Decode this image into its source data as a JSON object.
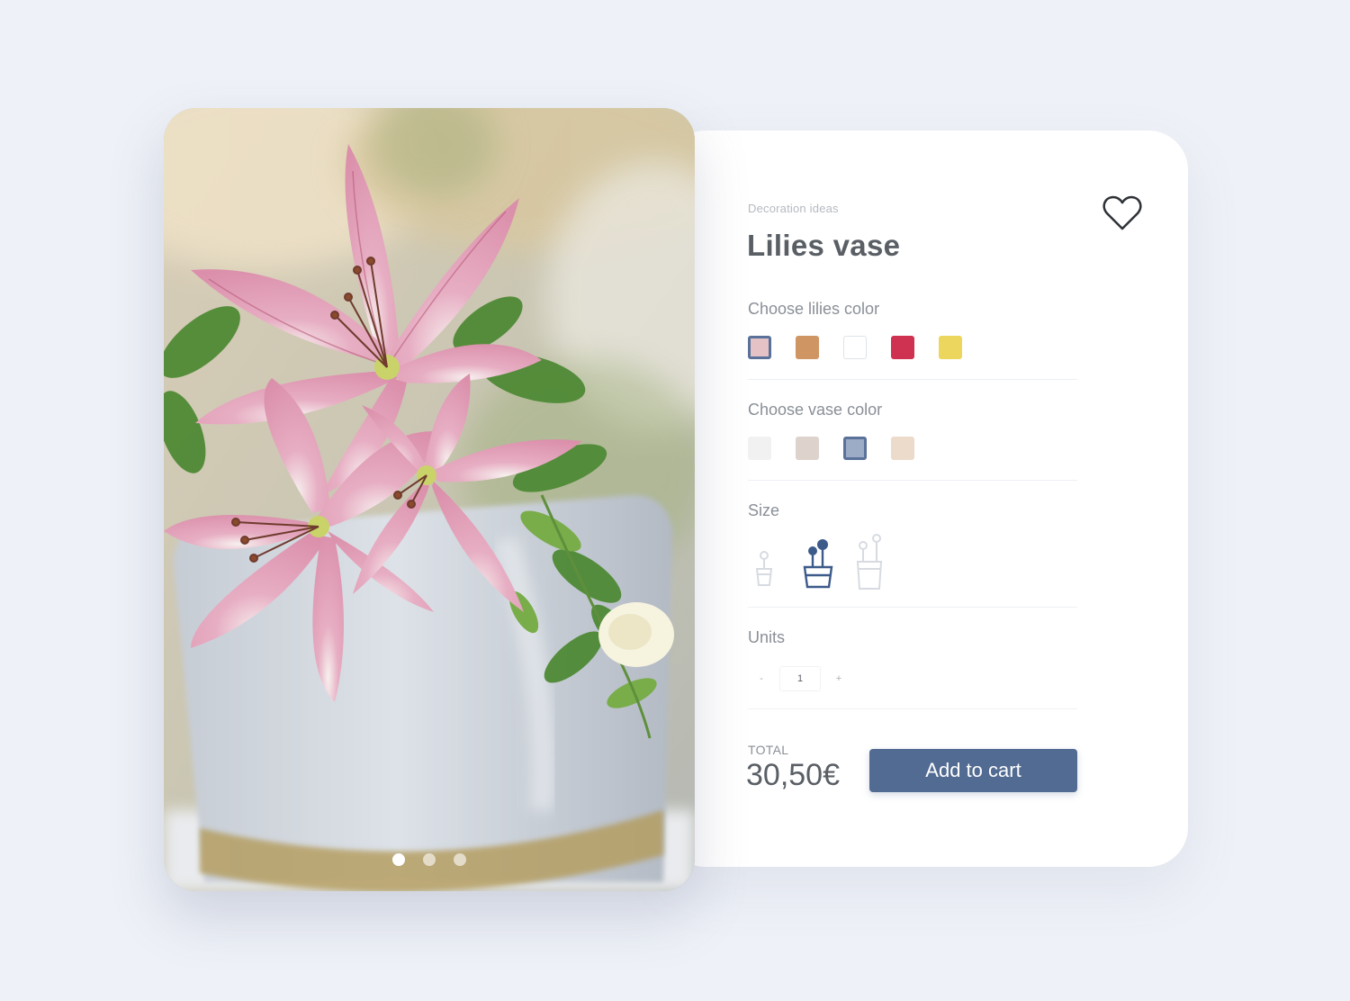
{
  "product": {
    "category": "Decoration ideas",
    "title": "Lilies vase",
    "lilies_color_label": "Choose lilies color",
    "lilies_colors": [
      "#e4c2c5",
      "#cf9563",
      "#ffffff",
      "#cf3150",
      "#ecd65e"
    ],
    "lilies_selected_index": 0,
    "vase_color_label": "Choose vase color",
    "vase_colors": [
      "#f1f1f1",
      "#ddd3cc",
      "#9cabc6",
      "#ecdbcb"
    ],
    "vase_selected_index": 2,
    "size_label": "Size",
    "sizes": [
      "small",
      "medium",
      "large"
    ],
    "size_selected_index": 1,
    "units_label": "Units",
    "units_decrement": "-",
    "units_value": "1",
    "units_increment": "+",
    "total_label": "TOTAL",
    "total_value": "30,50€",
    "add_to_cart_label": "Add to cart"
  },
  "carousel": {
    "slides": 3,
    "active_index": 0
  },
  "colors": {
    "accent": "#526b92",
    "background": "#eef1f7"
  },
  "icons": {
    "favorite": "heart-icon",
    "size_small": "small-flower-pot-icon",
    "size_medium": "medium-flower-pot-icon",
    "size_large": "large-flower-pot-icon"
  }
}
